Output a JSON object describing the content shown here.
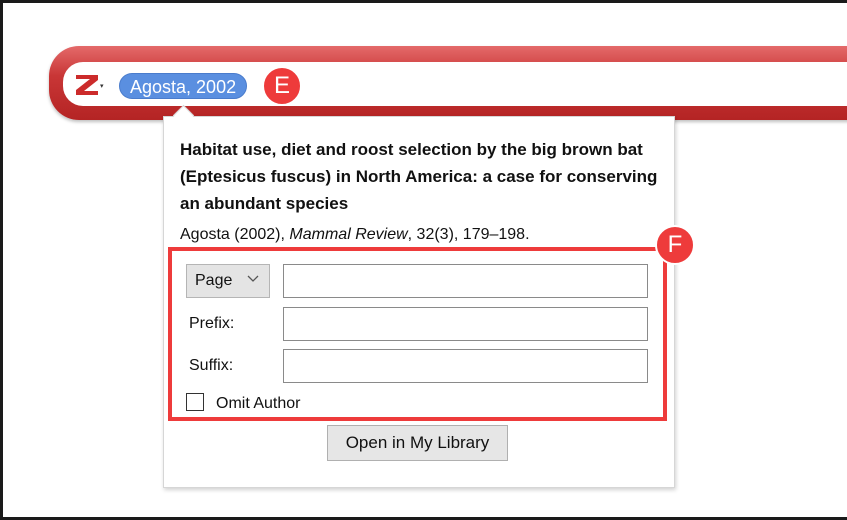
{
  "quick_format": {
    "citation_bubble": "Agosta, 2002",
    "badge_e": "E",
    "brand_color": "#c93636",
    "bubble_color": "#5a8fe0"
  },
  "popup": {
    "title": "Habitat use, diet and roost selection by the big brown bat (Eptesicus fuscus) in North America: a case for conserving an abundant species",
    "meta_prefix": "Agosta (2002), ",
    "meta_journal": "Mammal Review",
    "meta_suffix": ", 32(3), 179–198.",
    "badge_f": "F",
    "locator": {
      "selected": "Page",
      "value": ""
    },
    "prefix": {
      "label": "Prefix:",
      "value": ""
    },
    "suffix": {
      "label": "Suffix:",
      "value": ""
    },
    "omit_author": {
      "label": "Omit Author",
      "checked": false
    },
    "open_button": "Open in My Library",
    "highlight_color": "#ee3b3b"
  }
}
